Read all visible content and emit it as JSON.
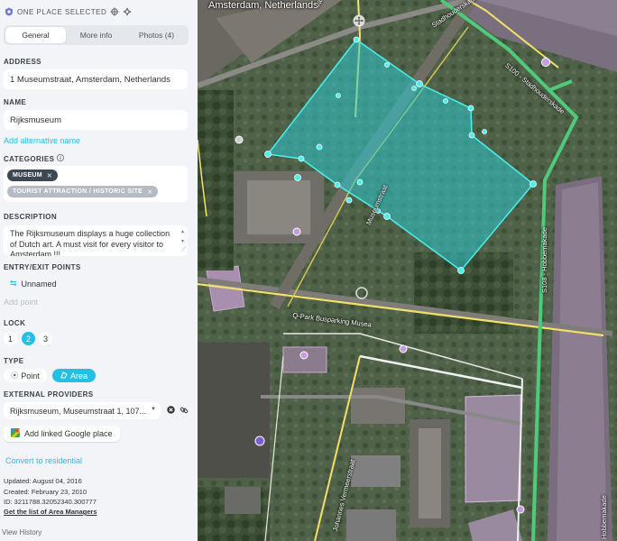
{
  "header": {
    "title": "ONE PLACE SELECTED"
  },
  "tabs": [
    {
      "label": "General"
    },
    {
      "label": "More info"
    },
    {
      "label": "Photos (4)"
    }
  ],
  "address": {
    "label": "ADDRESS",
    "value": "1 Museumstraat, Amsterdam, Netherlands"
  },
  "name": {
    "label": "NAME",
    "value": "Rijksmuseum",
    "add_alternative": "Add alternative name"
  },
  "categories": {
    "label": "CATEGORIES",
    "items": [
      {
        "label": "MUSEUM",
        "color": "#3d4852"
      },
      {
        "label": "TOURIST ATTRACTION / HISTORIC SITE",
        "color": "#b4bbc2"
      }
    ]
  },
  "description": {
    "label": "DESCRIPTION",
    "value": "The Rijksmuseum displays a huge collection of Dutch art. A must visit for every visitor to Amsterdam !!!"
  },
  "entry_exit": {
    "label": "ENTRY/EXIT POINTS",
    "item": "Unnamed",
    "add_point": "Add point"
  },
  "lock": {
    "label": "LOCK",
    "options": [
      "1",
      "2",
      "3"
    ],
    "selected": "2"
  },
  "type": {
    "label": "TYPE",
    "point": "Point",
    "area": "Area",
    "selected": "Area"
  },
  "external_providers": {
    "label": "EXTERNAL PROVIDERS",
    "value": "Rijksmuseum, Museumstraat 1, 107...",
    "add_google": "Add linked Google place"
  },
  "convert_link": "Convert to residential",
  "metadata": {
    "updated": "Updated: August 04, 2016",
    "created": "Created: February 23, 2010",
    "id": "ID: 3211788.32052340.300777",
    "area_managers": "Get the list of Area Managers"
  },
  "view_history": "View History",
  "map": {
    "location": "Amsterdam, Netherlands",
    "streets": {
      "jan_luijken": "Jan Luijkenstraat",
      "stadhouderskade": "S100 - Stadhouderskade",
      "museumstraat": "Museumstraat",
      "hobbemakade": "S108 - Hobbemakade",
      "qpark": "Q-Park Busparking Musea",
      "vermeer": "Johannes Vermeerstraat",
      "hobbemakade_short": "Hobbemakade",
      "stadhouders_top": "Stadhouderskade"
    }
  },
  "colors": {
    "accent": "#26bfe4",
    "selection": "#2cc9d0",
    "road_green": "#4fc97a"
  }
}
